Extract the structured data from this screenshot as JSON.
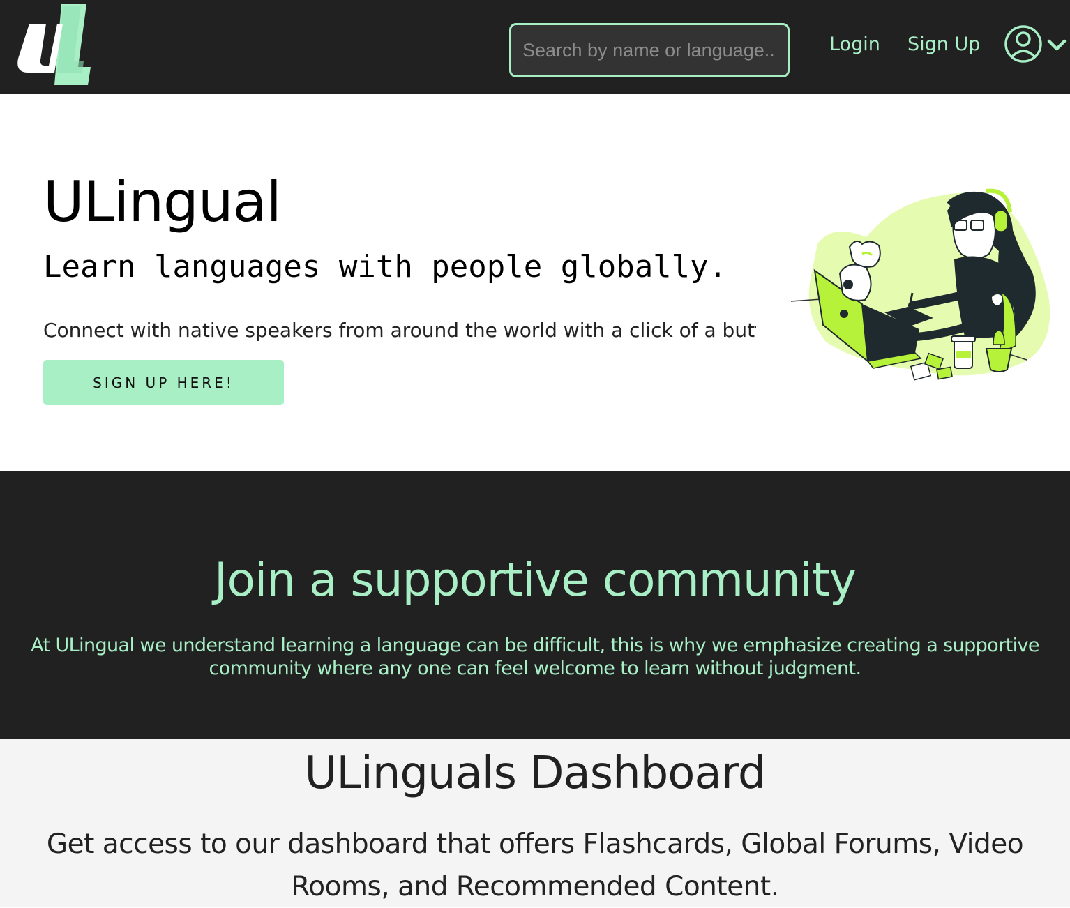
{
  "navbar": {
    "logo_alt": "UL",
    "search": {
      "placeholder": "Search by name or language..",
      "value": ""
    },
    "login_label": "Login",
    "signup_label": "Sign Up",
    "profile_icon": "user-circle-icon",
    "dropdown_icon": "chevron-down-icon"
  },
  "hero": {
    "title": "ULingual",
    "tagline": "Learn languages with people globally.",
    "description": "Connect with native speakers from around the world with a click of a button.",
    "button_label": "SIGN UP HERE!",
    "illustration": "girl-at-laptop-with-cat-illustration"
  },
  "community": {
    "title": "Join a supportive community",
    "text": "At ULingual we understand learning a language can be difficult, this is why we emphasize creating a supportive community where any one can feel welcome to learn without judgment."
  },
  "dashboard": {
    "title": "ULinguals Dashboard",
    "text": "Get access to our dashboard that offers Flashcards, Global Forums, Video Rooms, and Recommended Content."
  },
  "colors": {
    "dark": "#212121",
    "accent": "#a8efc6",
    "lime": "#b6f23a"
  }
}
